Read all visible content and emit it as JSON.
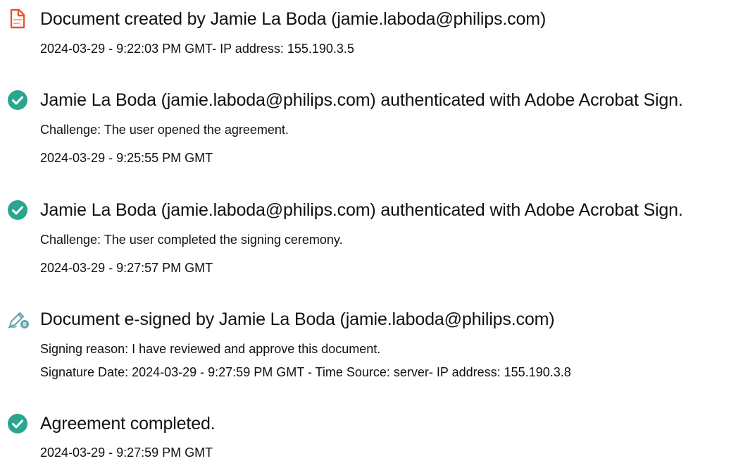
{
  "events": [
    {
      "icon": "document-icon",
      "title": "Document created by Jamie La Boda (jamie.laboda@philips.com)",
      "lines": [
        "2024-03-29 - 9:22:03 PM GMT- IP address: 155.190.3.5"
      ]
    },
    {
      "icon": "check-circle-icon",
      "title": "Jamie La Boda (jamie.laboda@philips.com) authenticated with Adobe Acrobat Sign.",
      "lines": [
        "Challenge: The user opened the agreement.",
        "2024-03-29 - 9:25:55 PM GMT"
      ]
    },
    {
      "icon": "check-circle-icon",
      "title": "Jamie La Boda (jamie.laboda@philips.com) authenticated with Adobe Acrobat Sign.",
      "lines": [
        "Challenge: The user completed the signing ceremony.",
        "2024-03-29 - 9:27:57 PM GMT"
      ]
    },
    {
      "icon": "pen-sign-icon",
      "title": "Document e-signed by Jamie La Boda (jamie.laboda@philips.com)",
      "lines": [
        "Signing reason: I have reviewed and approve this document.",
        "Signature Date: 2024-03-29 - 9:27:59 PM GMT - Time Source: server- IP address: 155.190.3.8"
      ]
    },
    {
      "icon": "check-circle-icon",
      "title": "Agreement completed.",
      "lines": [
        "2024-03-29 - 9:27:59 PM GMT"
      ]
    }
  ],
  "colors": {
    "check": "#2aa58f",
    "document": "#e8542c",
    "pen": "#5aa5a8"
  }
}
